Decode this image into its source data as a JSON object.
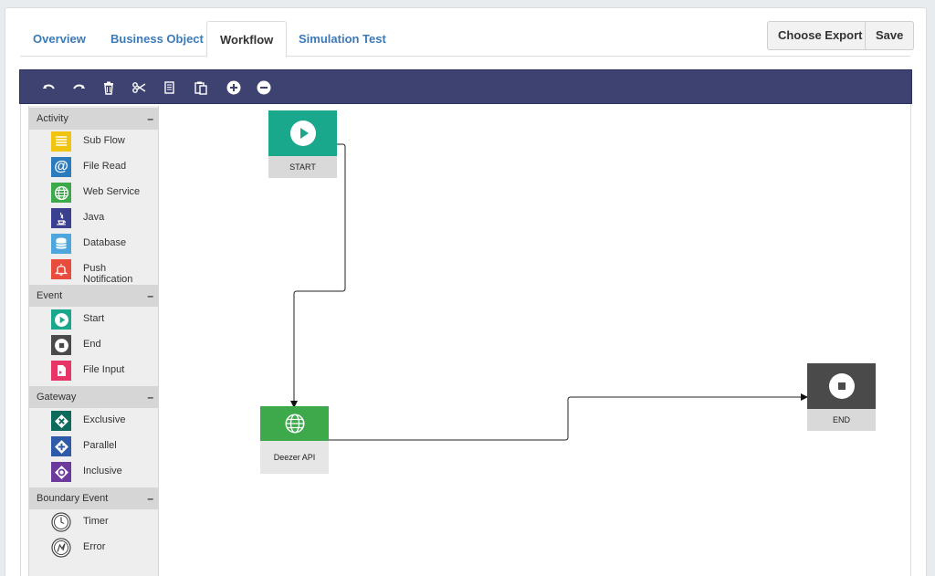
{
  "tabs": [
    {
      "label": "Overview"
    },
    {
      "label": "Business Object"
    },
    {
      "label": "Workflow",
      "active": true
    },
    {
      "label": "Simulation Test"
    }
  ],
  "actions": {
    "export_label": "Choose Export",
    "save_label": "Save"
  },
  "toolbar": [
    "undo-icon",
    "redo-icon",
    "trash-icon",
    "scissors-icon",
    "copy-icon",
    "paste-icon",
    "zoom-in-icon",
    "zoom-out-icon"
  ],
  "palette": {
    "collapse_symbol": "–",
    "sections": [
      {
        "title": "Activity",
        "items": [
          {
            "label": "Sub Flow",
            "icon": "list-icon",
            "color": "#f1c40f"
          },
          {
            "label": "File Read",
            "icon": "at-icon",
            "color": "#2b7bbd"
          },
          {
            "label": "Web Service",
            "icon": "globe-icon",
            "color": "#3da94a"
          },
          {
            "label": "Java",
            "icon": "java-icon",
            "color": "#3b3f8f"
          },
          {
            "label": "Database",
            "icon": "database-icon",
            "color": "#4ea6dc"
          },
          {
            "label": "Push Notification",
            "icon": "bell-icon",
            "color": "#e74c3c"
          }
        ]
      },
      {
        "title": "Event",
        "items": [
          {
            "label": "Start",
            "icon": "play-icon",
            "color": "#1aa88d"
          },
          {
            "label": "End",
            "icon": "stop-icon",
            "color": "#4a4a4a"
          },
          {
            "label": "File Input",
            "icon": "file-input-icon",
            "color": "#e73568"
          }
        ]
      },
      {
        "title": "Gateway",
        "items": [
          {
            "label": "Exclusive",
            "icon": "exclusive-gateway-icon",
            "color": "#0e6b5c"
          },
          {
            "label": "Parallel",
            "icon": "parallel-gateway-icon",
            "color": "#2f5aa8"
          },
          {
            "label": "Inclusive",
            "icon": "inclusive-gateway-icon",
            "color": "#6c3a9c"
          }
        ]
      },
      {
        "title": "Boundary Event",
        "items": [
          {
            "label": "Timer",
            "icon": "timer-icon",
            "color": "#444444"
          },
          {
            "label": "Error",
            "icon": "error-icon",
            "color": "#444444"
          }
        ]
      }
    ]
  },
  "diagram": {
    "nodes": [
      {
        "id": "start",
        "label": "START",
        "icon": "play-icon",
        "color": "#1aa88d"
      },
      {
        "id": "deezer",
        "label": "Deezer API",
        "icon": "globe-icon",
        "color": "#3da94a"
      },
      {
        "id": "end",
        "label": "END",
        "icon": "stop-icon",
        "color": "#4a4a4a"
      }
    ],
    "edges": [
      {
        "from": "start",
        "to": "deezer"
      },
      {
        "from": "deezer",
        "to": "end"
      }
    ]
  }
}
